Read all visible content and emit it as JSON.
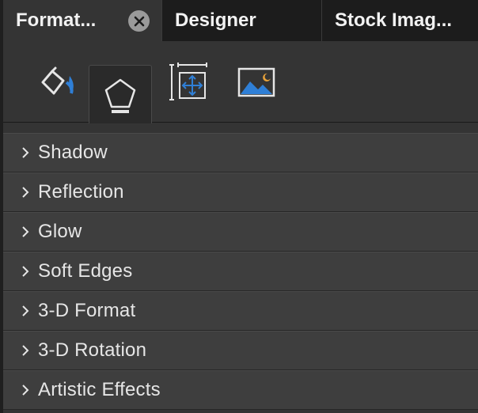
{
  "tabs": [
    {
      "label": "Format..."
    },
    {
      "label": "Designer"
    },
    {
      "label": "Stock Imag..."
    }
  ],
  "icon_tabs": [
    {
      "icon": "fill-line-icon"
    },
    {
      "icon": "shape-effects-icon"
    },
    {
      "icon": "size-properties-icon"
    },
    {
      "icon": "picture-icon"
    }
  ],
  "sections": [
    {
      "label": "Shadow"
    },
    {
      "label": "Reflection"
    },
    {
      "label": "Glow"
    },
    {
      "label": "Soft Edges"
    },
    {
      "label": "3-D Format"
    },
    {
      "label": "3-D Rotation"
    },
    {
      "label": "Artistic Effects"
    }
  ],
  "colors": {
    "accent_blue": "#2f7fd6",
    "panel": "#343434",
    "section": "#3e3e3e"
  }
}
